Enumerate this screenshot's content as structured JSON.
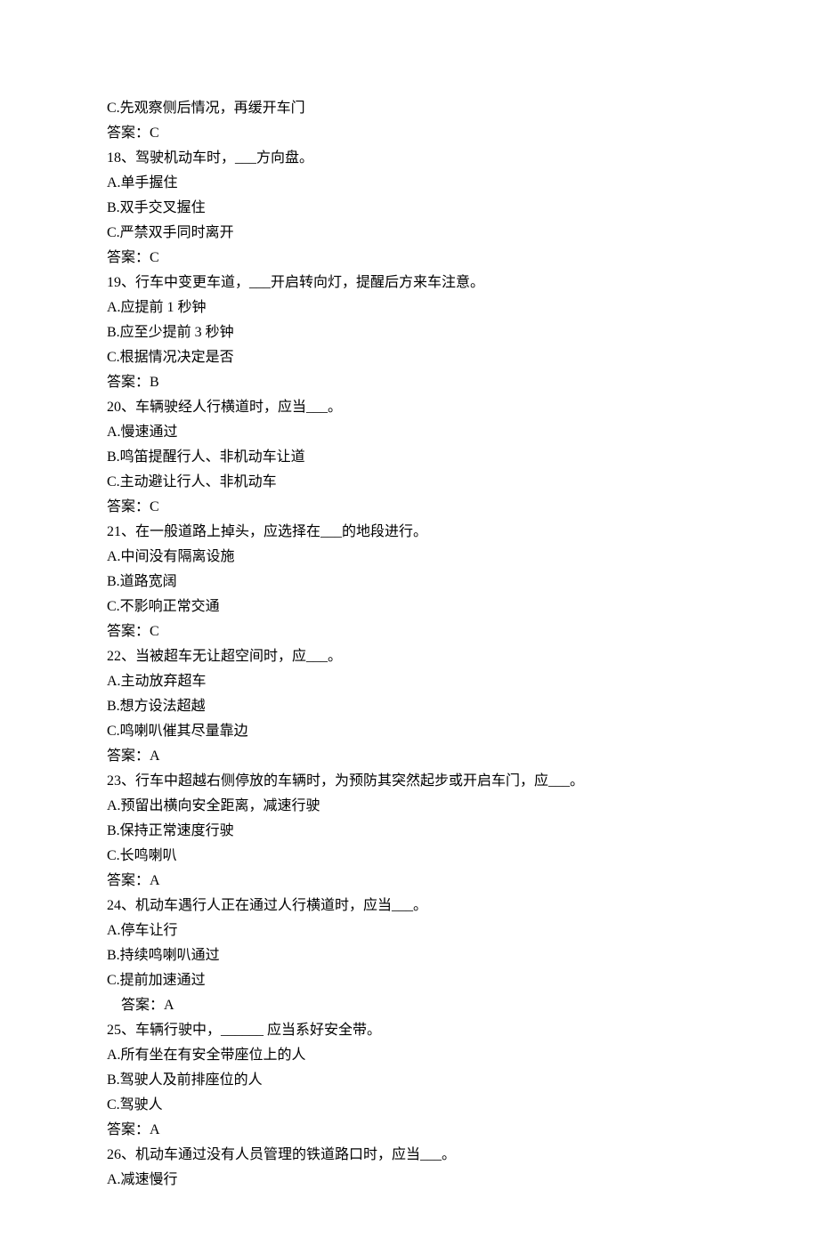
{
  "lines": [
    {
      "text": "C.先观察侧后情况，再缓开车门",
      "indent": false
    },
    {
      "text": "答案：C",
      "indent": false
    },
    {
      "text": "18、驾驶机动车时，___方向盘。",
      "indent": false
    },
    {
      "text": "A.单手握住",
      "indent": false
    },
    {
      "text": "B.双手交叉握住",
      "indent": false
    },
    {
      "text": "C.严禁双手同时离开",
      "indent": false
    },
    {
      "text": "答案：C",
      "indent": false
    },
    {
      "text": "19、行车中变更车道，___开启转向灯，提醒后方来车注意。",
      "indent": false
    },
    {
      "text": "A.应提前 1 秒钟",
      "indent": false
    },
    {
      "text": "B.应至少提前 3 秒钟",
      "indent": false
    },
    {
      "text": "C.根据情况决定是否",
      "indent": false
    },
    {
      "text": "答案：B",
      "indent": false
    },
    {
      "text": "20、车辆驶经人行横道时，应当___。",
      "indent": false
    },
    {
      "text": "A.慢速通过",
      "indent": false
    },
    {
      "text": "B.鸣笛提醒行人、非机动车让道",
      "indent": false
    },
    {
      "text": "C.主动避让行人、非机动车",
      "indent": false
    },
    {
      "text": "答案：C",
      "indent": false
    },
    {
      "text": "21、在一般道路上掉头，应选择在___的地段进行。",
      "indent": false
    },
    {
      "text": "A.中间没有隔离设施",
      "indent": false
    },
    {
      "text": "B.道路宽阔",
      "indent": false
    },
    {
      "text": "C.不影响正常交通",
      "indent": false
    },
    {
      "text": "答案：C",
      "indent": false
    },
    {
      "text": "22、当被超车无让超空间时，应___。",
      "indent": false
    },
    {
      "text": "A.主动放弃超车",
      "indent": false
    },
    {
      "text": "B.想方设法超越",
      "indent": false
    },
    {
      "text": "C.鸣喇叭催其尽量靠边",
      "indent": false
    },
    {
      "text": "答案：A",
      "indent": false
    },
    {
      "text": "23、行车中超越右侧停放的车辆时，为预防其突然起步或开启车门，应___。",
      "indent": false
    },
    {
      "text": "A.预留出横向安全距离，减速行驶",
      "indent": false
    },
    {
      "text": "B.保持正常速度行驶",
      "indent": false
    },
    {
      "text": "C.长鸣喇叭",
      "indent": false
    },
    {
      "text": "答案：A",
      "indent": false
    },
    {
      "text": "24、机动车遇行人正在通过人行横道时，应当___。",
      "indent": false
    },
    {
      "text": "A.停车让行",
      "indent": false
    },
    {
      "text": "B.持续鸣喇叭通过",
      "indent": false
    },
    {
      "text": "C.提前加速通过",
      "indent": false
    },
    {
      "text": "答案：A",
      "indent": true
    },
    {
      "text": "25、车辆行驶中，______ 应当系好安全带。",
      "indent": false
    },
    {
      "text": "A.所有坐在有安全带座位上的人",
      "indent": false
    },
    {
      "text": "B.驾驶人及前排座位的人",
      "indent": false
    },
    {
      "text": "C.驾驶人",
      "indent": false
    },
    {
      "text": "答案：A",
      "indent": false
    },
    {
      "text": "26、机动车通过没有人员管理的铁道路口时，应当___。",
      "indent": false
    },
    {
      "text": "A.减速慢行",
      "indent": false
    }
  ]
}
